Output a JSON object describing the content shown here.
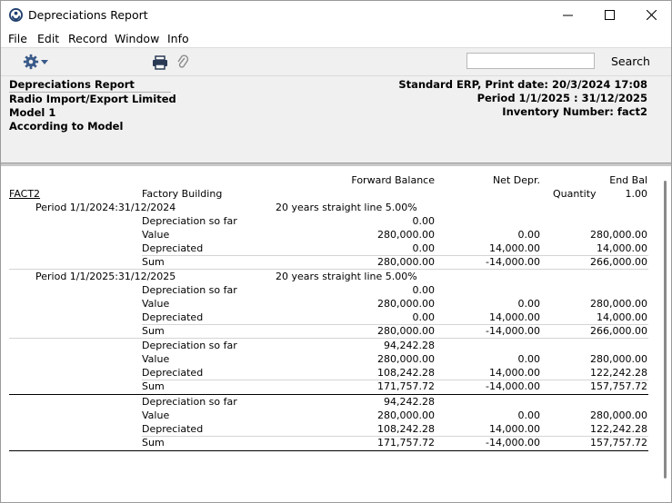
{
  "window": {
    "title": "Depreciations Report"
  },
  "menu": [
    "File",
    "Edit",
    "Record",
    "Window",
    "Info"
  ],
  "toolbar": {
    "search_label": "Search",
    "search_value": ""
  },
  "header": {
    "left": [
      "Depreciations Report",
      "Radio Import/Export Limited",
      "Model 1",
      "According to Model"
    ],
    "right": [
      "Standard ERP, Print date: 20/3/2024 17:08",
      "Period  1/1/2025 : 31/12/2025",
      "Inventory Number: fact2"
    ]
  },
  "report": {
    "columns": {
      "forward": "Forward Balance",
      "netdepr": "Net Depr.",
      "endbal": "End Bal"
    },
    "asset": {
      "code": "FACT2",
      "name": "Factory Building",
      "qty_label": "Quantity",
      "qty": "1.00"
    },
    "periods": [
      {
        "label": "Period 1/1/2024:31/12/2024",
        "method": "20 years straight line 5.00%",
        "rows": [
          {
            "label": "Depreciation so far",
            "forward": "0.00",
            "net": "",
            "end": ""
          },
          {
            "label": "Value",
            "forward": "280,000.00",
            "net": "0.00",
            "end": "280,000.00"
          },
          {
            "label": "Depreciated",
            "forward": "0.00",
            "net": "14,000.00",
            "end": "14,000.00"
          },
          {
            "label": "Sum",
            "forward": "280,000.00",
            "net": "-14,000.00",
            "end": "266,000.00"
          }
        ]
      },
      {
        "label": "Period 1/1/2025:31/12/2025",
        "method": "20 years straight line 5.00%",
        "rows": [
          {
            "label": "Depreciation so far",
            "forward": "0.00",
            "net": "",
            "end": ""
          },
          {
            "label": "Value",
            "forward": "280,000.00",
            "net": "0.00",
            "end": "280,000.00"
          },
          {
            "label": "Depreciated",
            "forward": "0.00",
            "net": "14,000.00",
            "end": "14,000.00"
          },
          {
            "label": "Sum",
            "forward": "280,000.00",
            "net": "-14,000.00",
            "end": "266,000.00"
          }
        ]
      }
    ],
    "asset_total": [
      {
        "label": "Depreciation so far",
        "forward": "94,242.28",
        "net": "",
        "end": ""
      },
      {
        "label": "Value",
        "forward": "280,000.00",
        "net": "0.00",
        "end": "280,000.00"
      },
      {
        "label": "Depreciated",
        "forward": "108,242.28",
        "net": "14,000.00",
        "end": "122,242.28"
      },
      {
        "label": "Sum",
        "forward": "171,757.72",
        "net": "-14,000.00",
        "end": "157,757.72"
      }
    ],
    "grand_total": [
      {
        "label": "Depreciation so far",
        "forward": "94,242.28",
        "net": "",
        "end": ""
      },
      {
        "label": "Value",
        "forward": "280,000.00",
        "net": "0.00",
        "end": "280,000.00"
      },
      {
        "label": "Depreciated",
        "forward": "108,242.28",
        "net": "14,000.00",
        "end": "122,242.28"
      },
      {
        "label": "Sum",
        "forward": "171,757.72",
        "net": "-14,000.00",
        "end": "157,757.72"
      }
    ]
  }
}
